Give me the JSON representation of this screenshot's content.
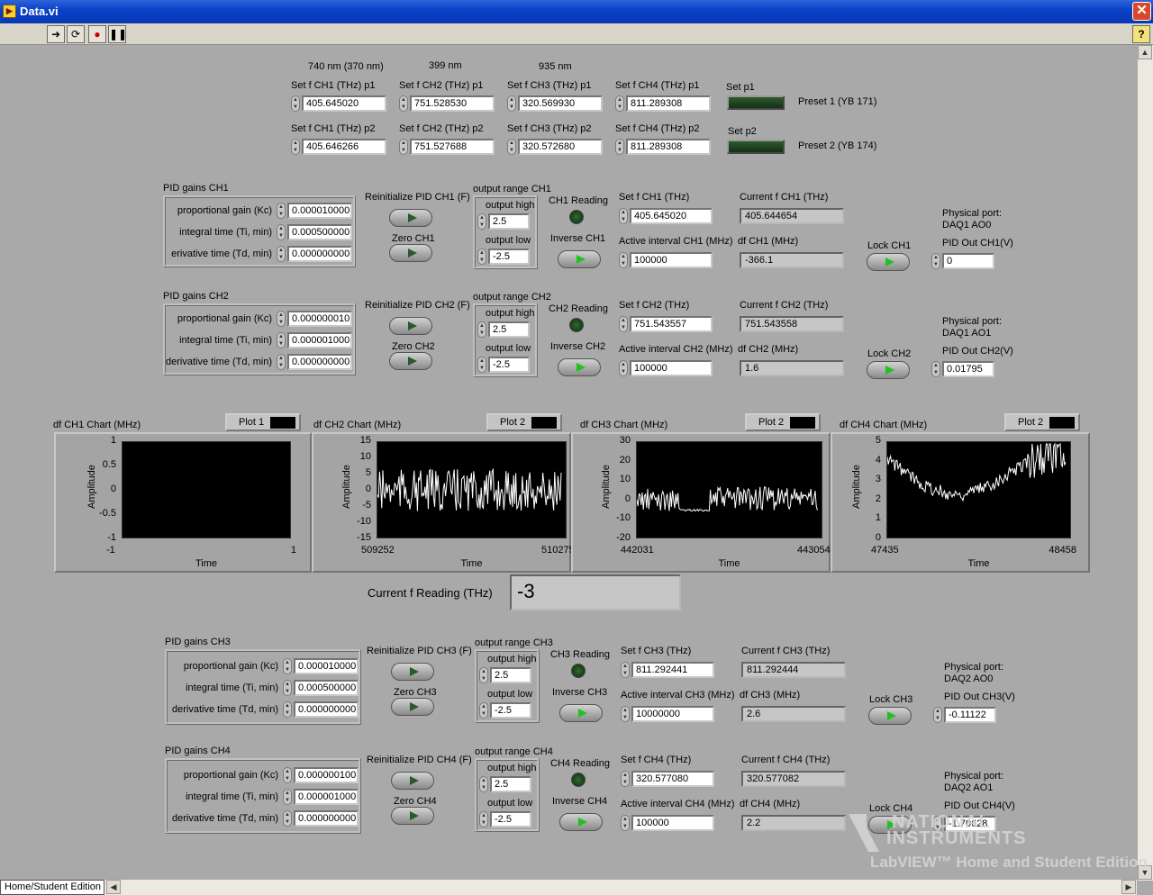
{
  "window": {
    "title": "Data.vi",
    "close": "✕"
  },
  "toolbar": {
    "help": "?"
  },
  "status": {
    "label": "Home/Student Edition"
  },
  "presets": {
    "wavelengths": [
      "740 nm (370 nm)",
      "399 nm",
      "935 nm"
    ],
    "p1": {
      "labels": [
        "Set f CH1 (THz) p1",
        "Set f CH2 (THz) p1",
        "Set f CH3 (THz) p1",
        "Set f CH4 (THz) p1"
      ],
      "values": [
        "405.645020",
        "751.528530",
        "320.569930",
        "811.289308"
      ],
      "set_label": "Set p1",
      "preset_label": "Preset 1 (YB 171)"
    },
    "p2": {
      "labels": [
        "Set f CH1 (THz) p2",
        "Set f CH2 (THz) p2",
        "Set f CH3 (THz) p2",
        "Set f CH4 (THz) p2"
      ],
      "values": [
        "405.646266",
        "751.527688",
        "320.572680",
        "811.289308"
      ],
      "set_label": "Set p2",
      "preset_label": "Preset 2 (YB 174)"
    }
  },
  "channels": [
    {
      "pid_title": "PID gains CH1",
      "kc_label": "proportional gain (Kc)",
      "ti_label": "integral time (Ti, min)",
      "td_label": "erivative time (Td, min)",
      "kc": "0.000010000",
      "ti": "0.000500000",
      "td": "0.000000000",
      "reinit": "Reinitialize PID CH1 (F)",
      "zero": "Zero CH1",
      "range_title": "output range CH1",
      "high_label": "output high",
      "high": "2.5",
      "low_label": "output low",
      "low": "-2.5",
      "reading": "CH1 Reading",
      "inverse": "Inverse CH1",
      "setf_label": "Set f CH1 (THz)",
      "setf": "405.645020",
      "curf_label": "Current f CH1 (THz)",
      "curf": "405.644654",
      "active_label": "Active interval CH1 (MHz)",
      "active": "100000",
      "df_label": "df CH1 (MHz)",
      "df": "-366.1",
      "lock": "Lock CH1",
      "port_label": "Physical port:",
      "port": "DAQ1 AO0",
      "pidout_label": "PID Out CH1(V)",
      "pidout": "0"
    },
    {
      "pid_title": "PID gains CH2",
      "kc_label": "proportional gain (Kc)",
      "ti_label": "integral time (Ti, min)",
      "td_label": "derivative time (Td, min)",
      "kc": "0.000000010",
      "ti": "0.000001000",
      "td": "0.000000000",
      "reinit": "Reinitialize PID CH2 (F)",
      "zero": "Zero CH2",
      "range_title": "output range CH2",
      "high_label": "output high",
      "high": "2.5",
      "low_label": "output low",
      "low": "-2.5",
      "reading": "CH2 Reading",
      "inverse": "Inverse CH2",
      "setf_label": "Set f CH2 (THz)",
      "setf": "751.543557",
      "curf_label": "Current f CH2 (THz)",
      "curf": "751.543558",
      "active_label": "Active interval CH2 (MHz)",
      "active": "100000",
      "df_label": "df CH2 (MHz)",
      "df": "1.6",
      "lock": "Lock CH2",
      "port_label": "Physical port:",
      "port": "DAQ1 AO1",
      "pidout_label": "PID Out CH2(V)",
      "pidout": "0.01795"
    },
    {
      "pid_title": "PID gains CH3",
      "kc_label": "proportional gain (Kc)",
      "ti_label": "integral time (Ti, min)",
      "td_label": "derivative time (Td, min)",
      "kc": "0.000010000",
      "ti": "0.000500000",
      "td": "0.000000000",
      "reinit": "Reinitialize PID CH3 (F)",
      "zero": "Zero CH3",
      "range_title": "output range CH3",
      "high_label": "output high",
      "high": "2.5",
      "low_label": "output low",
      "low": "-2.5",
      "reading": "CH3 Reading",
      "inverse": "Inverse CH3",
      "setf_label": "Set f CH3 (THz)",
      "setf": "811.292441",
      "curf_label": "Current f CH3 (THz)",
      "curf": "811.292444",
      "active_label": "Active interval CH3 (MHz)",
      "active": "10000000",
      "df_label": "df CH3 (MHz)",
      "df": "2.6",
      "lock": "Lock CH3",
      "port_label": "Physical port:",
      "port": "DAQ2 AO0",
      "pidout_label": "PID Out CH3(V)",
      "pidout": "-0.11122"
    },
    {
      "pid_title": "PID gains CH4",
      "kc_label": "proportional gain (Kc)",
      "ti_label": "integral time (Ti, min)",
      "td_label": "derivative time (Td, min)",
      "kc": "0.000000100",
      "ti": "0.000001000",
      "td": "0.000000000",
      "reinit": "Reinitialize PID CH4 (F)",
      "zero": "Zero CH4",
      "range_title": "output range CH4",
      "high_label": "output high",
      "high": "2.5",
      "low_label": "output low",
      "low": "-2.5",
      "reading": "CH4 Reading",
      "inverse": "Inverse CH4",
      "setf_label": "Set f CH4 (THz)",
      "setf": "320.577080",
      "curf_label": "Current f CH4 (THz)",
      "curf": "320.577082",
      "active_label": "Active interval CH4 (MHz)",
      "active": "100000",
      "df_label": "df CH4 (MHz)",
      "df": "2.2",
      "lock": "Lock CH4",
      "port_label": "Physical port:",
      "port": "DAQ2 AO1",
      "pidout_label": "PID Out CH4(V)",
      "pidout": "-1.70628"
    }
  ],
  "reading": {
    "label": "Current f Reading (THz)",
    "value": "-3"
  },
  "watermark": {
    "line1": "NATIONAL",
    "line2": "INSTRUMENTS",
    "line3": "LabVIEW™ Home and Student Edition"
  },
  "chart_data": [
    {
      "type": "line",
      "title": "df CH1 Chart (MHz)",
      "legend": "Plot 1",
      "xlabel": "Time",
      "ylabel": "Amplitude",
      "xlim": [
        -1,
        1
      ],
      "ylim": [
        -1,
        1
      ],
      "yticks": [
        "1",
        "0.5",
        "0",
        "-0.5",
        "-1"
      ],
      "xticks": [
        "-1",
        "1"
      ],
      "series": [
        {
          "name": "Plot 1",
          "values": []
        }
      ]
    },
    {
      "type": "line",
      "title": "df CH2 Chart (MHz)",
      "legend": "Plot 2",
      "xlabel": "Time",
      "ylabel": "Amplitude",
      "xlim": [
        509252,
        510275
      ],
      "ylim": [
        -15,
        15
      ],
      "yticks": [
        "15",
        "10",
        "5",
        "0",
        "-5",
        "-10",
        "-15"
      ],
      "xticks": [
        "509252",
        "510275"
      ],
      "series": [
        {
          "name": "Plot 2",
          "values": []
        }
      ]
    },
    {
      "type": "line",
      "title": "df CH3 Chart (MHz)",
      "legend": "Plot 2",
      "xlabel": "Time",
      "ylabel": "Amplitude",
      "xlim": [
        442031,
        443054
      ],
      "ylim": [
        -20,
        30
      ],
      "yticks": [
        "30",
        "20",
        "10",
        "0",
        "-10",
        "-20"
      ],
      "xticks": [
        "442031",
        "443054"
      ],
      "series": [
        {
          "name": "Plot 2",
          "values": []
        }
      ]
    },
    {
      "type": "line",
      "title": "df CH4 Chart (MHz)",
      "legend": "Plot 2",
      "xlabel": "Time",
      "ylabel": "Amplitude",
      "xlim": [
        47435,
        48458
      ],
      "ylim": [
        0,
        5
      ],
      "yticks": [
        "5",
        "4",
        "3",
        "2",
        "1",
        "0"
      ],
      "xticks": [
        "47435",
        "48458"
      ],
      "series": [
        {
          "name": "Plot 2",
          "values": []
        }
      ]
    }
  ]
}
